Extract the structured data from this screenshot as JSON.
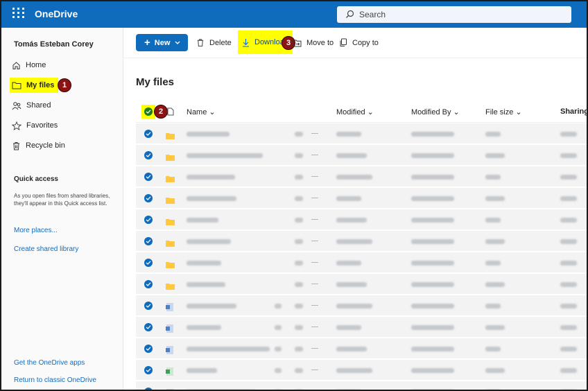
{
  "header": {
    "app_name": "OneDrive",
    "search_placeholder": "Search"
  },
  "sidebar": {
    "user_name": "Tomás Esteban Corey",
    "items": [
      {
        "label": "Home",
        "icon": "home-icon"
      },
      {
        "label": "My files",
        "icon": "folder-icon",
        "highlighted": true
      },
      {
        "label": "Shared",
        "icon": "people-icon"
      },
      {
        "label": "Favorites",
        "icon": "star-icon"
      },
      {
        "label": "Recycle bin",
        "icon": "trash-icon"
      }
    ],
    "quick_access_title": "Quick access",
    "quick_access_desc": "As you open files from shared libraries, they'll appear in this Quick access list.",
    "more_places": "More places...",
    "create_shared_library": "Create shared library",
    "get_apps": "Get the OneDrive apps",
    "return_classic": "Return to classic OneDrive"
  },
  "toolbar": {
    "new_label": "New",
    "delete_label": "Delete",
    "download_label": "Download",
    "move_label": "Move to",
    "copy_label": "Copy to"
  },
  "main": {
    "title": "My files",
    "columns": {
      "name": "Name",
      "modified": "Modified",
      "modified_by": "Modified By",
      "file_size": "File size",
      "sharing": "Sharing"
    }
  },
  "annotations": {
    "badge1": "1",
    "badge2": "2",
    "badge3": "3"
  },
  "colors": {
    "brand": "#0f6cbd",
    "highlight": "#ffff00",
    "badge": "#8b1313",
    "folder": "#ffc83d"
  },
  "rows": [
    {
      "type": "folder"
    },
    {
      "type": "folder"
    },
    {
      "type": "folder"
    },
    {
      "type": "folder"
    },
    {
      "type": "folder"
    },
    {
      "type": "folder"
    },
    {
      "type": "folder"
    },
    {
      "type": "folder"
    },
    {
      "type": "doc"
    },
    {
      "type": "doc"
    },
    {
      "type": "doc"
    },
    {
      "type": "sheet"
    },
    {
      "type": "doc"
    }
  ]
}
